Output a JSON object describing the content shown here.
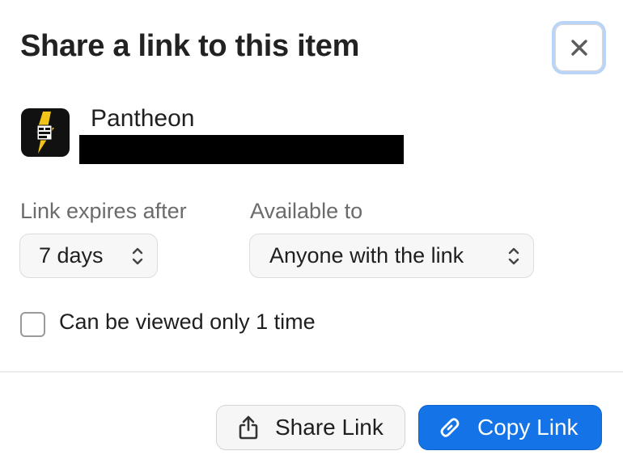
{
  "dialog": {
    "title": "Share a link to this item",
    "close_icon": "close-icon"
  },
  "item": {
    "name": "Pantheon",
    "icon": "pantheon-app-icon"
  },
  "expiry": {
    "label": "Link expires after",
    "value": "7 days"
  },
  "availability": {
    "label": "Available to",
    "value": "Anyone with the link"
  },
  "view_once": {
    "label": "Can be viewed only 1 time",
    "checked": false
  },
  "actions": {
    "share_label": "Share Link",
    "share_icon": "share-icon",
    "copy_label": "Copy Link",
    "copy_icon": "link-icon"
  },
  "colors": {
    "accent": "#1473e6",
    "focus_ring": "#b9d4f7"
  }
}
